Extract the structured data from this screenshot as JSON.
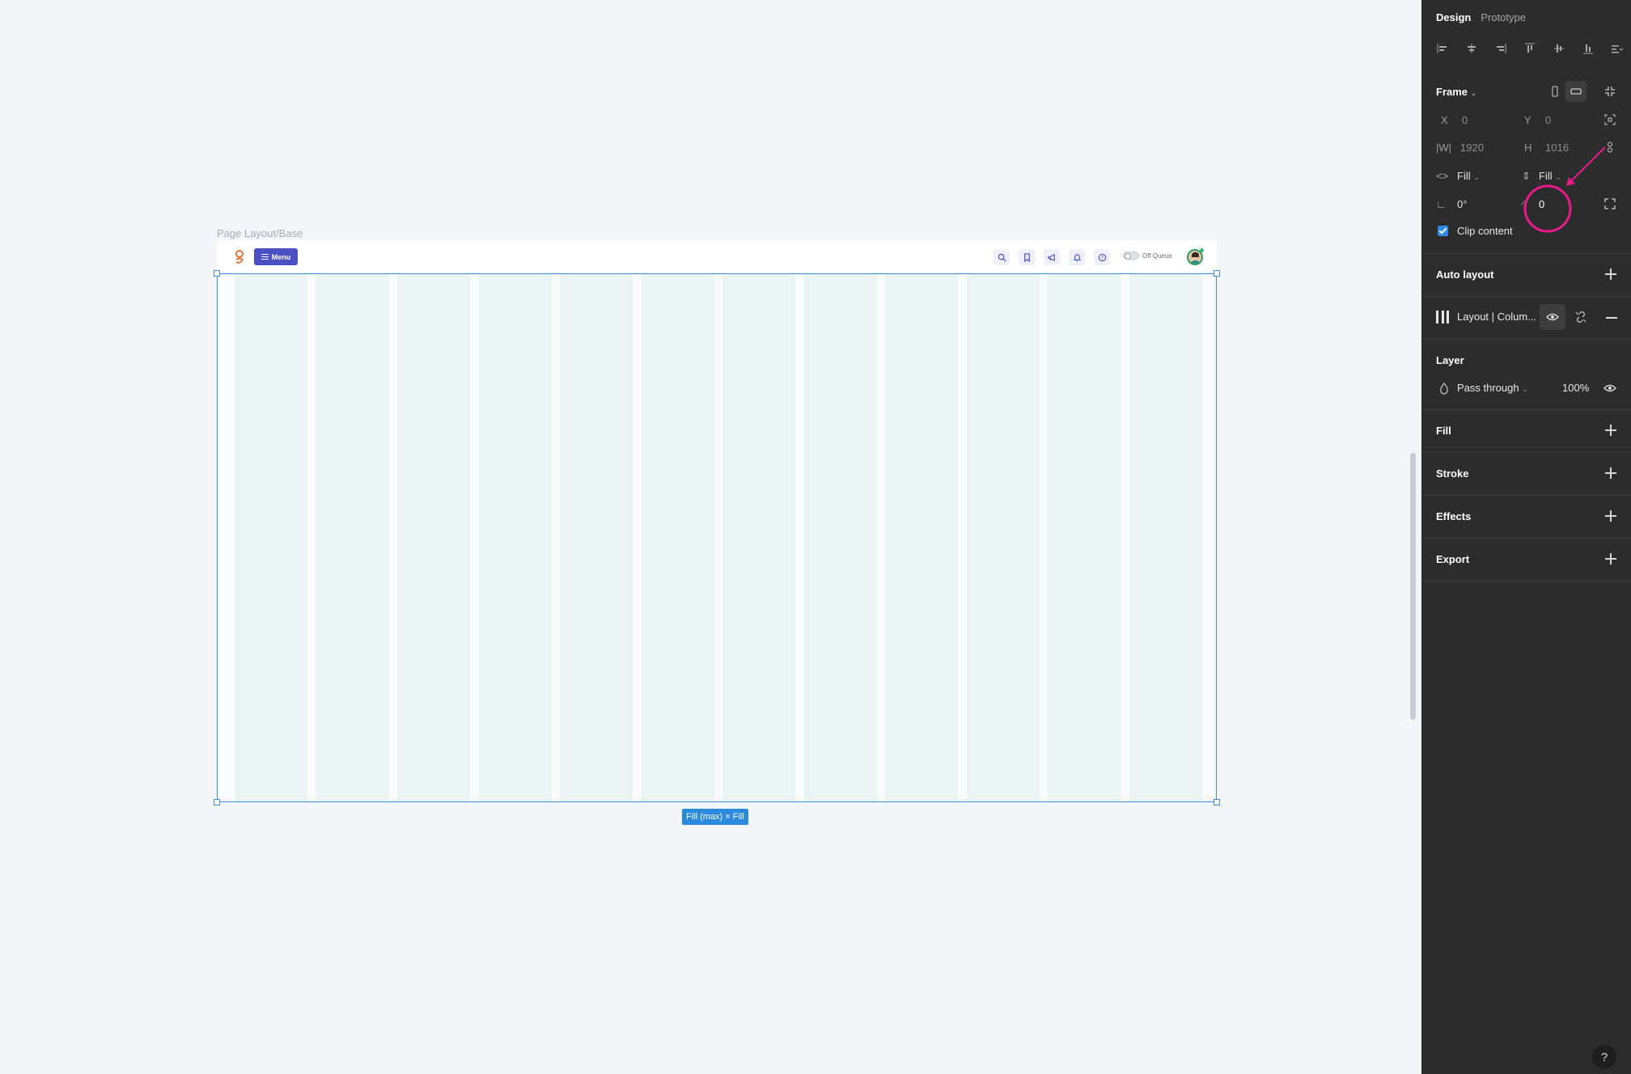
{
  "canvas": {
    "frame_label": "Page Layout/Base",
    "size_badge": "Fill (max) × Fill",
    "topbar": {
      "menu_label": "Menu",
      "queue_label": "Off Queue",
      "icons": [
        "search-icon",
        "bookmark-icon",
        "megaphone-icon",
        "bell-icon",
        "help-icon"
      ]
    },
    "layout_grid": {
      "columns": 12,
      "column_color": "#eaf4f5"
    }
  },
  "panel": {
    "tabs": {
      "design": "Design",
      "prototype": "Prototype"
    },
    "frame": {
      "title": "Frame",
      "x_label": "X",
      "x_value": "0",
      "y_label": "Y",
      "y_value": "0",
      "w_label": "W",
      "w_value": "1920",
      "h_label": "H",
      "h_value": "1016",
      "horizontal_resizing": "Fill",
      "vertical_resizing": "Fill",
      "rotation": "0°",
      "corner_radius": "0",
      "clip_content_label": "Clip content",
      "clip_content_checked": true
    },
    "auto_layout": "Auto layout",
    "layout_grid": "Layout | Colum...",
    "layer": {
      "title": "Layer",
      "blend_mode": "Pass through",
      "opacity": "100%"
    },
    "fill": "Fill",
    "stroke": "Stroke",
    "effects": "Effects",
    "export": "Export",
    "help": "?"
  },
  "colors": {
    "accent": "#2d8ae5",
    "annotation": "#e8198b",
    "menu_button": "#4b4fc4",
    "panel_bg": "#2c2c2c"
  }
}
